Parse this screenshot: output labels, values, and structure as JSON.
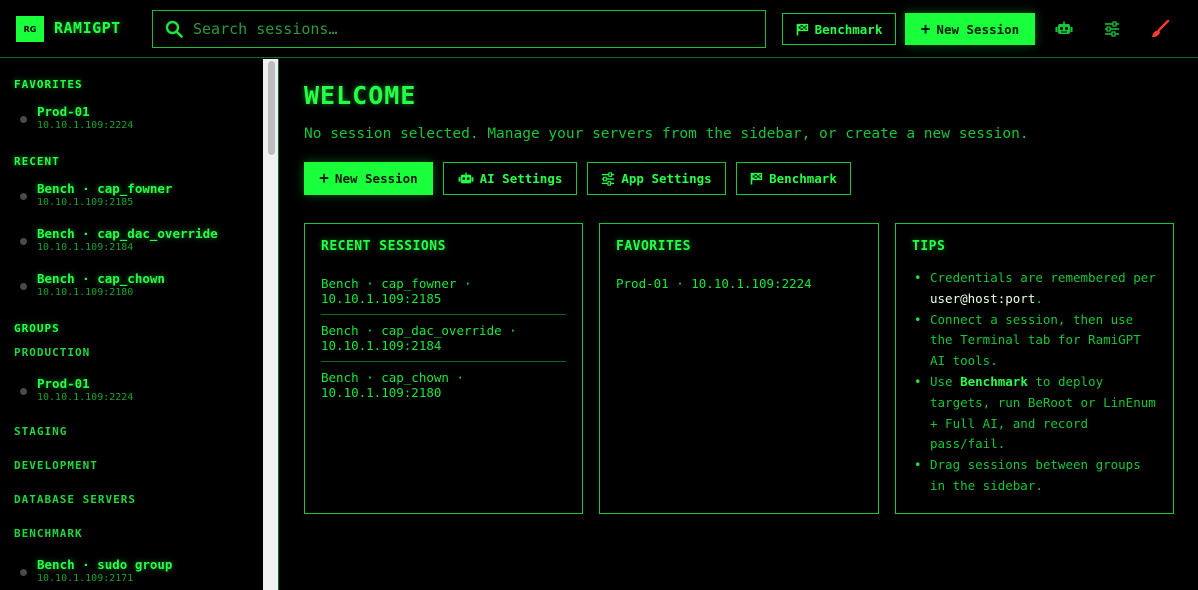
{
  "app": {
    "logo": "RG",
    "title": "RAMIGPT"
  },
  "search": {
    "placeholder": "Search sessions…"
  },
  "header": {
    "benchmark_label": "Benchmark",
    "new_session_label": "New Session"
  },
  "sidebar": {
    "favorites_title": "FAVORITES",
    "favorites": [
      {
        "name": "Prod-01",
        "addr": "10.10.1.109:2224"
      }
    ],
    "recent_title": "RECENT",
    "recent": [
      {
        "name": "Bench · cap_fowner",
        "addr": "10.10.1.109:2185"
      },
      {
        "name": "Bench · cap_dac_override",
        "addr": "10.10.1.109:2184"
      },
      {
        "name": "Bench · cap_chown",
        "addr": "10.10.1.109:2180"
      }
    ],
    "groups_title": "GROUPS",
    "groups": [
      {
        "name": "PRODUCTION",
        "items": [
          {
            "name": "Prod-01",
            "addr": "10.10.1.109:2224"
          }
        ]
      },
      {
        "name": "STAGING",
        "items": []
      },
      {
        "name": "DEVELOPMENT",
        "items": []
      },
      {
        "name": "DATABASE SERVERS",
        "items": []
      },
      {
        "name": "BENCHMARK",
        "items": [
          {
            "name": "Bench · sudo group",
            "addr": "10.10.1.109:2171"
          }
        ]
      }
    ]
  },
  "main": {
    "title": "WELCOME",
    "subtitle": "No session selected. Manage your servers from the sidebar, or create a new session.",
    "actions": {
      "new_session": "New Session",
      "ai_settings": "AI Settings",
      "app_settings": "App Settings",
      "benchmark": "Benchmark"
    },
    "recent_card": {
      "title": "RECENT SESSIONS",
      "items": [
        {
          "line1": "Bench · cap_fowner ·",
          "line2": "10.10.1.109:2185"
        },
        {
          "line1": "Bench · cap_dac_override ·",
          "line2": "10.10.1.109:2184"
        },
        {
          "line1": "Bench · cap_chown ·",
          "line2": "10.10.1.109:2180"
        }
      ]
    },
    "favorites_card": {
      "title": "FAVORITES",
      "items": [
        {
          "text": "Prod-01 · 10.10.1.109:2224"
        }
      ]
    },
    "tips_card": {
      "title": "TIPS",
      "tip1_a": "Credentials are remembered per ",
      "tip1_code": "user@host:port",
      "tip1_b": ".",
      "tip2": "Connect a session, then use the Terminal tab for RamiGPT AI tools.",
      "tip3_a": "Use ",
      "tip3_bold": "Benchmark",
      "tip3_b": " to deploy targets, run BeRoot or LinEnum + Full AI, and record pass/fail.",
      "tip4": "Drag sessions between groups in the sidebar."
    }
  },
  "colors": {
    "accent": "#1aff3c",
    "text": "#18e83c",
    "border": "#18c83a",
    "background": "#000000",
    "danger": "#ff3b2f"
  }
}
